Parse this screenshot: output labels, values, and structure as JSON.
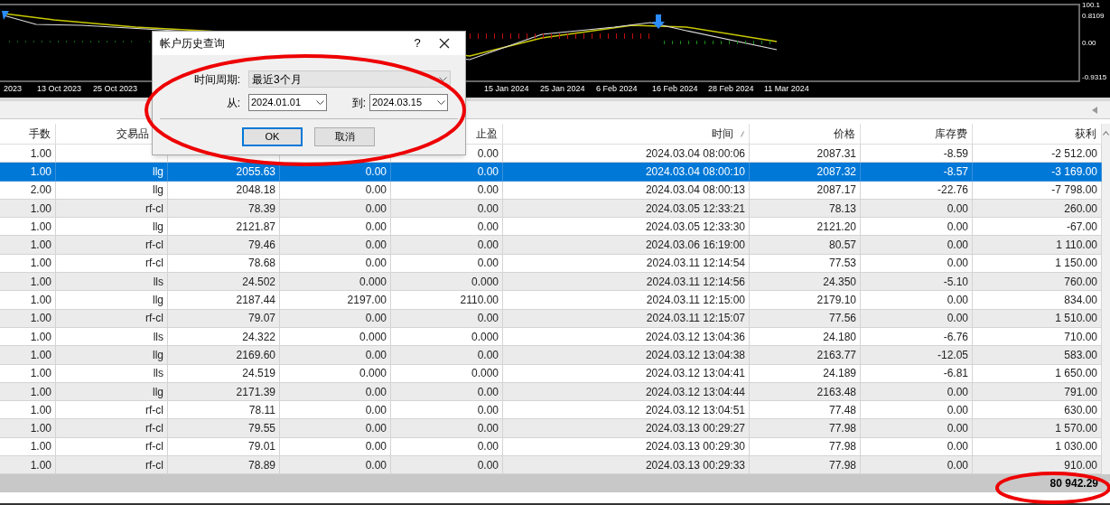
{
  "chart": {
    "y_axis_labels": [
      "100.1",
      "0.8109",
      "0.00",
      "-0.9315"
    ],
    "x_axis_labels": [
      "2023",
      "13 Oct 2023",
      "25 Oct 2023",
      "15 Jan 2024",
      "25 Jan 2024",
      "6 Feb 2024",
      "16 Feb 2024",
      "28 Feb 2024",
      "11 Mar 2024"
    ]
  },
  "table": {
    "columns": [
      {
        "label": "手数",
        "sorted": false
      },
      {
        "label": "交易品",
        "sorted": false
      },
      null,
      null,
      {
        "label": "止盈",
        "sorted": false
      },
      {
        "label": "时间",
        "sorted": true
      },
      {
        "label": "价格",
        "sorted": false
      },
      {
        "label": "库存费",
        "sorted": false
      },
      {
        "label": "获利",
        "sorted": false
      }
    ],
    "rows": [
      {
        "selected": false,
        "cells": [
          "1.00",
          null,
          null,
          null,
          "0.00",
          "2024.03.04 08:00:06",
          "2087.31",
          "-8.59",
          "-2 512.00"
        ]
      },
      {
        "selected": true,
        "cells": [
          "1.00",
          "llg",
          "2055.63",
          "0.00",
          "0.00",
          "2024.03.04 08:00:10",
          "2087.32",
          "-8.57",
          "-3 169.00"
        ]
      },
      {
        "selected": false,
        "cells": [
          "2.00",
          "llg",
          "2048.18",
          "0.00",
          "0.00",
          "2024.03.04 08:00:13",
          "2087.17",
          "-22.76",
          "-7 798.00"
        ]
      },
      {
        "selected": false,
        "cells": [
          "1.00",
          "rf-cl",
          "78.39",
          "0.00",
          "0.00",
          "2024.03.05 12:33:21",
          "78.13",
          "0.00",
          "260.00"
        ]
      },
      {
        "selected": false,
        "cells": [
          "1.00",
          "llg",
          "2121.87",
          "0.00",
          "0.00",
          "2024.03.05 12:33:30",
          "2121.20",
          "0.00",
          "-67.00"
        ]
      },
      {
        "selected": false,
        "cells": [
          "1.00",
          "rf-cl",
          "79.46",
          "0.00",
          "0.00",
          "2024.03.06 16:19:00",
          "80.57",
          "0.00",
          "1 110.00"
        ]
      },
      {
        "selected": false,
        "cells": [
          "1.00",
          "rf-cl",
          "78.68",
          "0.00",
          "0.00",
          "2024.03.11 12:14:54",
          "77.53",
          "0.00",
          "1 150.00"
        ]
      },
      {
        "selected": false,
        "cells": [
          "1.00",
          "lls",
          "24.502",
          "0.000",
          "0.000",
          "2024.03.11 12:14:56",
          "24.350",
          "-5.10",
          "760.00"
        ]
      },
      {
        "selected": false,
        "cells": [
          "1.00",
          "llg",
          "2187.44",
          "2197.00",
          "2110.00",
          "2024.03.11 12:15:00",
          "2179.10",
          "0.00",
          "834.00"
        ]
      },
      {
        "selected": false,
        "cells": [
          "1.00",
          "rf-cl",
          "79.07",
          "0.00",
          "0.00",
          "2024.03.11 12:15:07",
          "77.56",
          "0.00",
          "1 510.00"
        ]
      },
      {
        "selected": false,
        "cells": [
          "1.00",
          "lls",
          "24.322",
          "0.000",
          "0.000",
          "2024.03.12 13:04:36",
          "24.180",
          "-6.76",
          "710.00"
        ]
      },
      {
        "selected": false,
        "cells": [
          "1.00",
          "llg",
          "2169.60",
          "0.00",
          "0.00",
          "2024.03.12 13:04:38",
          "2163.77",
          "-12.05",
          "583.00"
        ]
      },
      {
        "selected": false,
        "cells": [
          "1.00",
          "lls",
          "24.519",
          "0.000",
          "0.000",
          "2024.03.12 13:04:41",
          "24.189",
          "-6.81",
          "1 650.00"
        ]
      },
      {
        "selected": false,
        "cells": [
          "1.00",
          "llg",
          "2171.39",
          "0.00",
          "0.00",
          "2024.03.12 13:04:44",
          "2163.48",
          "0.00",
          "791.00"
        ]
      },
      {
        "selected": false,
        "cells": [
          "1.00",
          "rf-cl",
          "78.11",
          "0.00",
          "0.00",
          "2024.03.12 13:04:51",
          "77.48",
          "0.00",
          "630.00"
        ]
      },
      {
        "selected": false,
        "cells": [
          "1.00",
          "rf-cl",
          "79.55",
          "0.00",
          "0.00",
          "2024.03.13 00:29:27",
          "77.98",
          "0.00",
          "1 570.00"
        ]
      },
      {
        "selected": false,
        "cells": [
          "1.00",
          "rf-cl",
          "79.01",
          "0.00",
          "0.00",
          "2024.03.13 00:29:30",
          "77.98",
          "0.00",
          "1 030.00"
        ]
      },
      {
        "selected": false,
        "cells": [
          "1.00",
          "rf-cl",
          "78.89",
          "0.00",
          "0.00",
          "2024.03.13 00:29:33",
          "77.98",
          "0.00",
          "910.00"
        ]
      }
    ],
    "total": "80 942.29"
  },
  "dialog": {
    "title": "帐户历史查询",
    "help": "?",
    "period": {
      "label": "时间周期:",
      "value": "最近3个月"
    },
    "from": {
      "label": "从:",
      "value": "2024.01.01"
    },
    "to": {
      "label": "到:",
      "value": "2024.03.15"
    },
    "buttons": [
      {
        "label": "OK",
        "selected": true
      },
      {
        "label": "取消",
        "selected": false
      }
    ]
  }
}
